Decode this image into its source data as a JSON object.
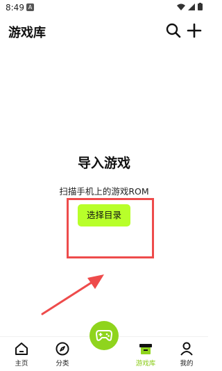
{
  "status": {
    "time": "8:49",
    "a": "A"
  },
  "header": {
    "title": "游戏库"
  },
  "empty": {
    "title": "导入游戏",
    "description": "扫描手机上的游戏ROM",
    "button": "选择目录"
  },
  "nav": {
    "items": [
      {
        "label": "主页",
        "icon": "home-icon"
      },
      {
        "label": "分类",
        "icon": "compass-icon"
      },
      {
        "label": "游戏库",
        "icon": "library-icon",
        "active": true
      },
      {
        "label": "我的",
        "icon": "profile-icon"
      }
    ],
    "fab_icon": "gamepad-icon"
  },
  "colors": {
    "accent": "#b8ff2a",
    "fab": "#8fd41d",
    "active": "#8acb16",
    "annotation": "#ee4b4b"
  }
}
